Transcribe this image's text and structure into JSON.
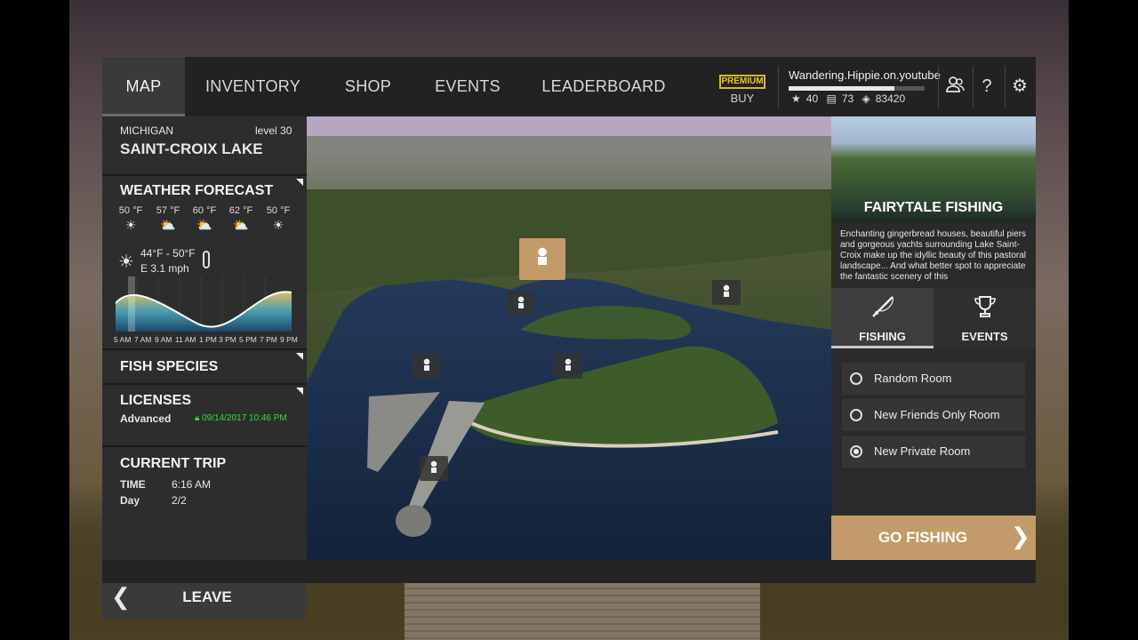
{
  "nav": {
    "tabs": [
      {
        "label": "MAP",
        "active": true
      },
      {
        "label": "INVENTORY",
        "active": false
      },
      {
        "label": "SHOP",
        "active": false
      },
      {
        "label": "EVENTS",
        "active": false
      },
      {
        "label": "LEADERBOARD",
        "active": false
      }
    ],
    "premium_label": "PREMIUM",
    "buy_label": "BUY",
    "icons": [
      "friends-icon",
      "help-icon",
      "settings-icon"
    ]
  },
  "profile": {
    "name": "Wandering.Hippie.on.youtube",
    "xp_progress": 0.78,
    "stars": "40",
    "silver": "73",
    "credits": "83420"
  },
  "location": {
    "state": "MICHIGAN",
    "level": "level 30",
    "name": "SAINT-CROIX LAKE"
  },
  "weather": {
    "title": "WEATHER FORECAST",
    "forecast": [
      {
        "temp": "50 °F",
        "icon": "sun-icon"
      },
      {
        "temp": "57 °F",
        "icon": "partly-cloudy-icon"
      },
      {
        "temp": "60 °F",
        "icon": "partly-cloudy-icon"
      },
      {
        "temp": "62 °F",
        "icon": "partly-cloudy-icon"
      },
      {
        "temp": "50 °F",
        "icon": "sun-icon"
      }
    ],
    "current_temp": "44°F - 50°F",
    "current_wind": "E 3.1 mph",
    "hours": [
      "5 AM",
      "7 AM",
      "9 AM",
      "11 AM",
      "1 PM",
      "3 PM",
      "5 PM",
      "7 PM",
      "9 PM"
    ]
  },
  "fish_species": {
    "title": "FISH SPECIES"
  },
  "licenses": {
    "title": "LICENSES",
    "type": "Advanced",
    "expires": "09/14/2017 10:46 PM"
  },
  "trip": {
    "title": "CURRENT TRIP",
    "time_label": "TIME",
    "time_value": "6:16 AM",
    "day_label": "Day",
    "day_value": "2/2"
  },
  "leave_label": "LEAVE",
  "spot": {
    "title": "FAIRYTALE FISHING",
    "description": "Enchanting gingerbread houses, beautiful piers and gorgeous yachts surrounding Lake Saint-Croix make up the idyllic beauty of this pastoral landscape... And what better spot to appreciate the fantastic scenery of this"
  },
  "right_tabs": [
    {
      "label": "FISHING",
      "icon": "fishing-rod-icon",
      "active": true
    },
    {
      "label": "EVENTS",
      "icon": "trophy-icon",
      "active": false
    }
  ],
  "rooms": [
    {
      "label": "Random Room",
      "selected": false
    },
    {
      "label": "New Friends Only Room",
      "selected": false
    },
    {
      "label": "New Private Room",
      "selected": true
    }
  ],
  "go_label": "GO FISHING",
  "colors": {
    "accent": "#c39a6a",
    "premium": "#e8c830",
    "license_valid": "#33dd33"
  }
}
